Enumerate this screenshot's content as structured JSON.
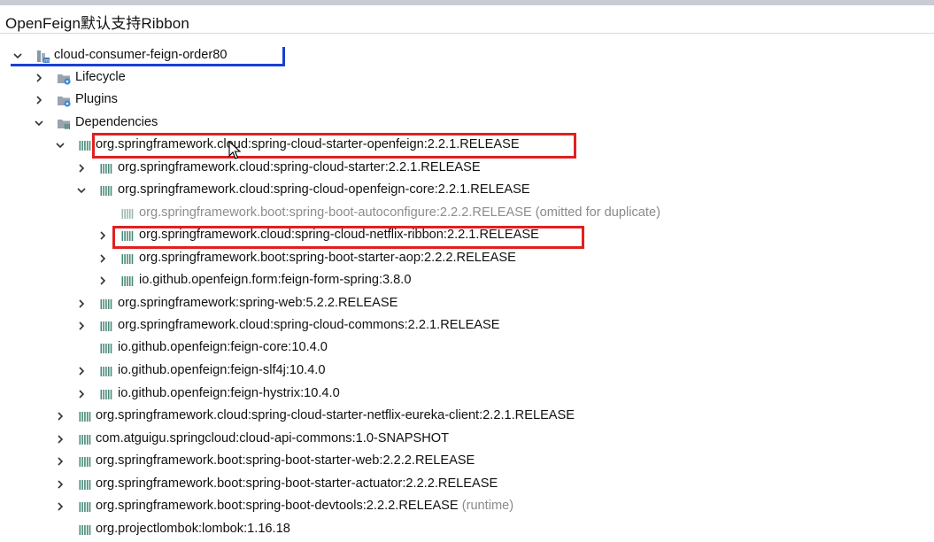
{
  "window": {
    "title": "OpenFeign默认支持Ribbon"
  },
  "tree": {
    "root": {
      "label": "cloud-consumer-feign-order80",
      "icon": "maven-module-icon",
      "expanded": true
    },
    "rows": [
      {
        "label": "Lifecycle",
        "icon": "lifecycle-folder-icon",
        "arrow": "collapsed"
      },
      {
        "label": "Plugins",
        "icon": "plugins-folder-icon",
        "arrow": "collapsed"
      },
      {
        "label": "Dependencies",
        "icon": "dependencies-folder-icon",
        "arrow": "expanded"
      },
      {
        "label": "org.springframework.cloud:spring-cloud-starter-openfeign:2.2.1.RELEASE",
        "icon": "library-icon",
        "arrow": "expanded",
        "highlighted": true
      },
      {
        "label": "org.springframework.cloud:spring-cloud-starter:2.2.1.RELEASE",
        "icon": "library-icon",
        "arrow": "collapsed"
      },
      {
        "label": "org.springframework.cloud:spring-cloud-openfeign-core:2.2.1.RELEASE",
        "icon": "library-icon",
        "arrow": "expanded"
      },
      {
        "label": "org.springframework.boot:spring-boot-autoconfigure:2.2.2.RELEASE",
        "note": "(omitted for duplicate)",
        "icon": "library-icon",
        "arrow": "none",
        "dim": true
      },
      {
        "label": "org.springframework.cloud:spring-cloud-netflix-ribbon:2.2.1.RELEASE",
        "icon": "library-icon",
        "arrow": "collapsed",
        "highlighted": true
      },
      {
        "label": "org.springframework.boot:spring-boot-starter-aop:2.2.2.RELEASE",
        "icon": "library-icon",
        "arrow": "collapsed"
      },
      {
        "label": "io.github.openfeign.form:feign-form-spring:3.8.0",
        "icon": "library-icon",
        "arrow": "collapsed"
      },
      {
        "label": "org.springframework:spring-web:5.2.2.RELEASE",
        "icon": "library-icon",
        "arrow": "collapsed"
      },
      {
        "label": "org.springframework.cloud:spring-cloud-commons:2.2.1.RELEASE",
        "icon": "library-icon",
        "arrow": "collapsed"
      },
      {
        "label": "io.github.openfeign:feign-core:10.4.0",
        "icon": "library-icon",
        "arrow": "none"
      },
      {
        "label": "io.github.openfeign:feign-slf4j:10.4.0",
        "icon": "library-icon",
        "arrow": "collapsed"
      },
      {
        "label": "io.github.openfeign:feign-hystrix:10.4.0",
        "icon": "library-icon",
        "arrow": "collapsed"
      },
      {
        "label": "org.springframework.cloud:spring-cloud-starter-netflix-eureka-client:2.2.1.RELEASE",
        "icon": "library-icon",
        "arrow": "collapsed"
      },
      {
        "label": "com.atguigu.springcloud:cloud-api-commons:1.0-SNAPSHOT",
        "icon": "library-icon",
        "arrow": "collapsed"
      },
      {
        "label": "org.springframework.boot:spring-boot-starter-web:2.2.2.RELEASE",
        "icon": "library-icon",
        "arrow": "collapsed"
      },
      {
        "label": "org.springframework.boot:spring-boot-starter-actuator:2.2.2.RELEASE",
        "icon": "library-icon",
        "arrow": "collapsed"
      },
      {
        "label": "org.springframework.boot:spring-boot-devtools:2.2.2.RELEASE",
        "note": "(runtime)",
        "icon": "library-icon",
        "arrow": "collapsed"
      },
      {
        "label": "org.projectlombok:lombok:1.16.18",
        "icon": "library-icon",
        "arrow": "none"
      }
    ]
  },
  "colors": {
    "highlight_red": "#e02020",
    "underline_blue": "#1a3fd6",
    "library_icon": "#4a8a7a"
  }
}
